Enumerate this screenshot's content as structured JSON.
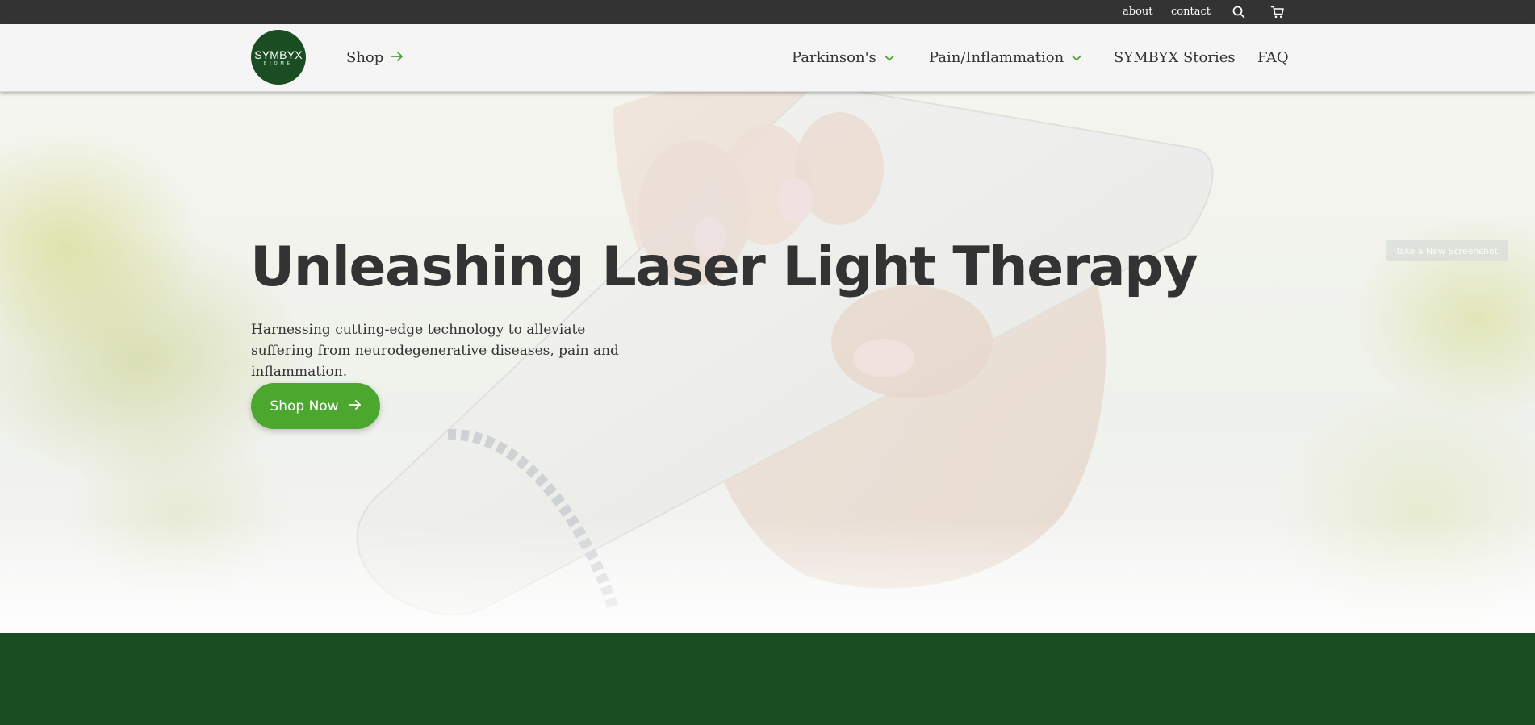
{
  "topbar": {
    "about_label": "about",
    "contact_label": "contact",
    "search_icon": "search-icon",
    "cart_icon": "cart-icon",
    "background": "#333333"
  },
  "nav": {
    "logo": {
      "text": "SYMBYX",
      "subtext": "BIOME"
    },
    "shop_label": "Shop",
    "items": [
      {
        "label": "Parkinson's",
        "icon": "chevron-down-icon"
      },
      {
        "label": "Pain/Inflammation",
        "icon": "chevron-down-icon"
      },
      {
        "label": "SYMBYX Stories"
      },
      {
        "label": "FAQ"
      }
    ]
  },
  "hero": {
    "title": "Unleashing Laser Light Therapy",
    "subtitle": "Harnessing cutting-edge technology to alleviate suffering from neurodegenerative diseases, pain and inflammation.",
    "cta_label": "Shop Now",
    "screenshot_button": "Take a New Screenshot"
  },
  "colors": {
    "brand_green": "#1b4d23",
    "accent_green": "#4ca72f",
    "text_dark": "#333333"
  }
}
